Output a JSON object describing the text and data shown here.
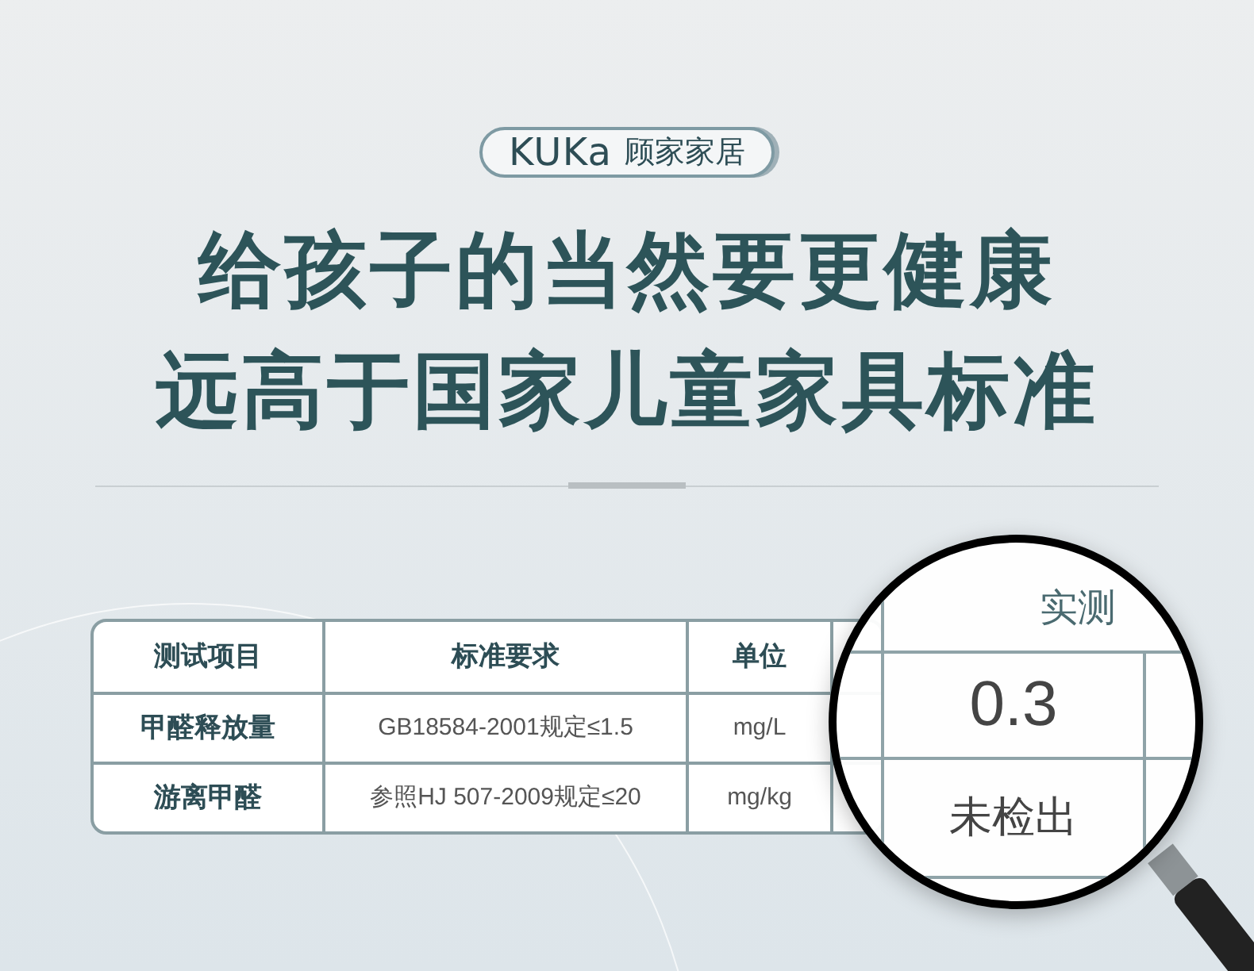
{
  "brand": {
    "logo": "KUKa",
    "name": "顾家家居"
  },
  "headline": [
    "给孩子的当然要更健康",
    "远高于国家儿童家具标准"
  ],
  "table": {
    "columns": [
      "测试项目",
      "标准要求",
      "单位",
      "实测"
    ],
    "rows": [
      [
        "甲醛释放量",
        "GB18584-2001规定≤1.5",
        "mg/L",
        "0.3"
      ],
      [
        "游离甲醛",
        "参照HJ 507-2009规定≤20",
        "mg/kg",
        "未检出"
      ]
    ]
  }
}
